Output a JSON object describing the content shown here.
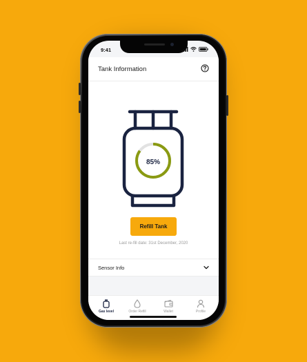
{
  "status": {
    "time": "9:41"
  },
  "header": {
    "title": "Tank Information",
    "help_icon": "help-circle-icon"
  },
  "tank": {
    "level_percent": 85,
    "level_label": "85%",
    "ring_color": "#8A9A12",
    "track_color": "#E2E2E2",
    "outline_color": "#1A2340"
  },
  "refill": {
    "button_label": "Refill Tank",
    "last_refill": "Last re-fill date: 31st December, 2020"
  },
  "sensor": {
    "label": "Sensor Info",
    "chevron_icon": "chevron-down-icon"
  },
  "tabs": [
    {
      "label": "Gas level",
      "icon": "gas-cylinder-icon",
      "active": true
    },
    {
      "label": "Order Refill",
      "icon": "drop-icon",
      "active": false
    },
    {
      "label": "Wallet",
      "icon": "wallet-icon",
      "active": false
    },
    {
      "label": "Profile",
      "icon": "user-icon",
      "active": false
    }
  ],
  "colors": {
    "background": "#F7A90C",
    "accent": "#F7A90C",
    "dark": "#1A2340"
  }
}
